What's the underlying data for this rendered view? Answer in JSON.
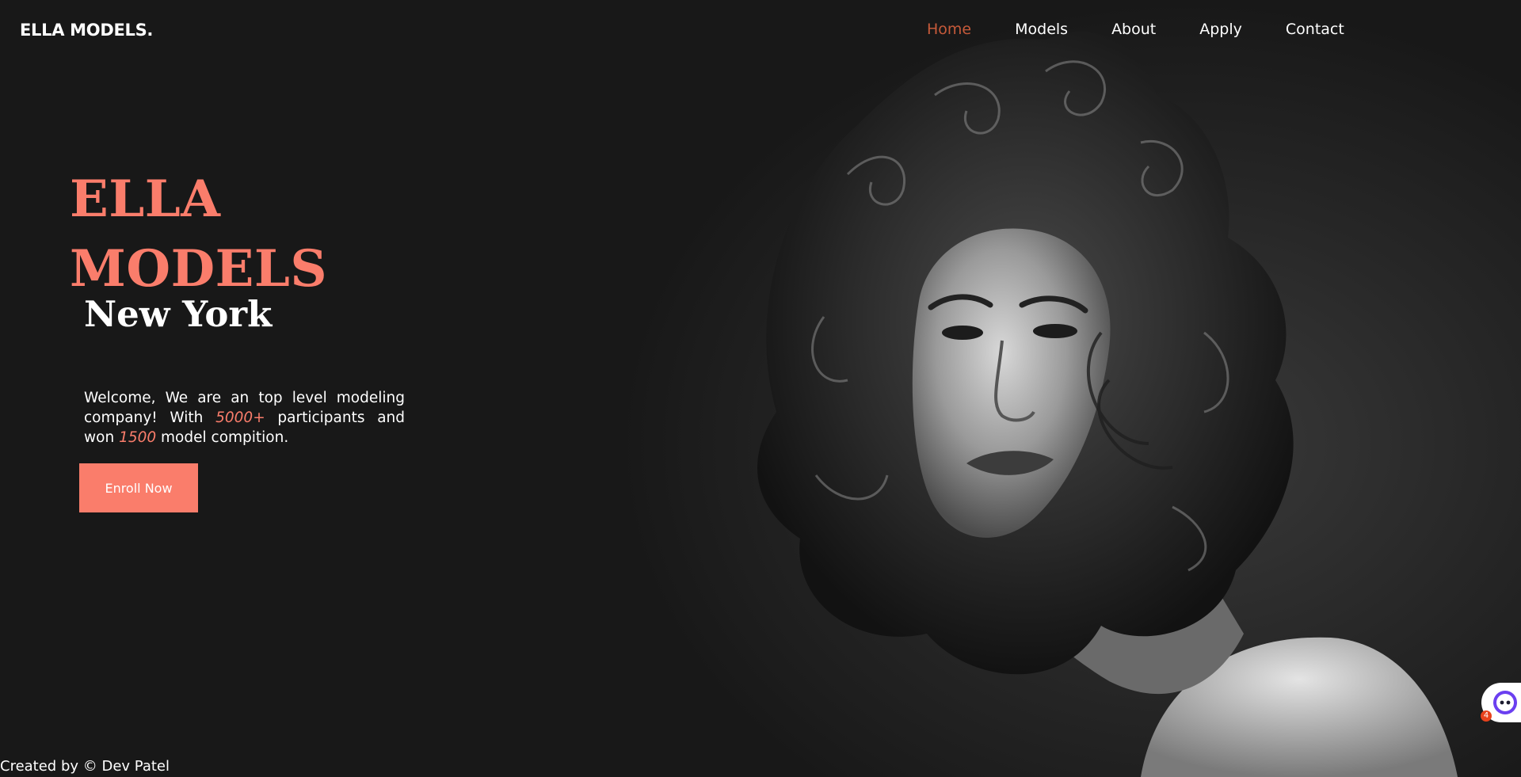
{
  "brand": "ELLA MODELS.",
  "nav": {
    "items": [
      {
        "label": "Home",
        "active": true
      },
      {
        "label": "Models",
        "active": false
      },
      {
        "label": "About",
        "active": false
      },
      {
        "label": "Apply",
        "active": false
      },
      {
        "label": "Contact",
        "active": false
      }
    ]
  },
  "hero": {
    "title_line1": "ELLA",
    "title_line2": "MODELS",
    "subtitle": "New York",
    "desc_part1": "Welcome, We are an top level modeling company! With ",
    "desc_highlight1": "5000+",
    "desc_part2": " participants and won ",
    "desc_highlight2": "1500",
    "desc_part3": " model compition.",
    "button_label": "Enroll Now"
  },
  "footer": {
    "credit": "Created by © Dev Patel"
  },
  "chat_widget": {
    "badge_count": "4"
  },
  "colors": {
    "accent": "#fa7d6b",
    "nav_active": "#c65a3a",
    "background": "#161616"
  }
}
